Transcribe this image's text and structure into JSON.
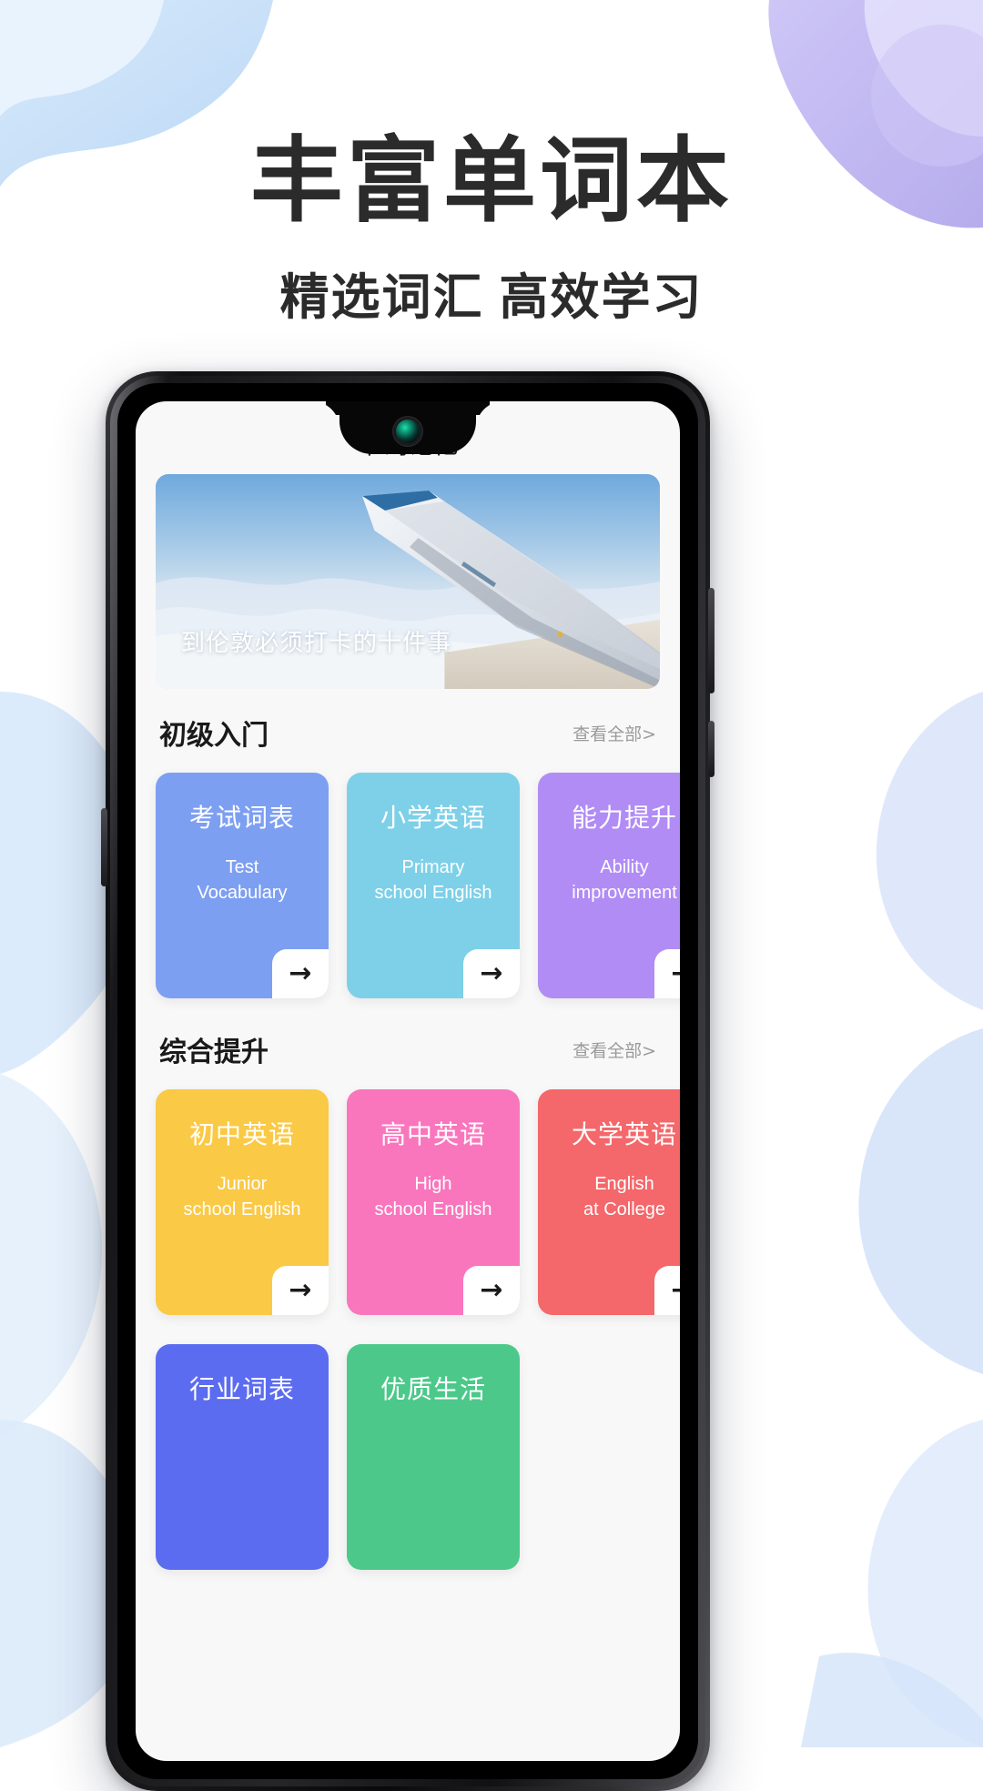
{
  "hero": {
    "title": "丰富单词本",
    "subtitle": "精选词汇 高效学习"
  },
  "colors": {
    "bg_blue": "#cfe4f7",
    "bg_purple": "#c9c2f2",
    "bg_page": "#ffffff",
    "text_dark": "#2b2b2b",
    "muted": "#9a9a9a"
  },
  "app": {
    "title": "单词记忆",
    "banner": {
      "caption": "到伦敦必须打卡的十件事"
    },
    "sections": [
      {
        "title": "初级入门",
        "more_label": "查看全部>",
        "cards": [
          {
            "cn": "考试词表",
            "en": "Test\nVocabulary",
            "color": "#7d9ff2",
            "arrow": "→"
          },
          {
            "cn": "小学英语",
            "en": "Primary\nschool English",
            "color": "#7ed0e8",
            "arrow": "→"
          },
          {
            "cn": "能力提升",
            "en": "Ability\nimprovement",
            "color": "#b18cf5",
            "arrow": "→"
          }
        ]
      },
      {
        "title": "综合提升",
        "more_label": "查看全部>",
        "cards": [
          {
            "cn": "初中英语",
            "en": "Junior\nschool English",
            "color": "#fac945",
            "arrow": "→"
          },
          {
            "cn": "高中英语",
            "en": "High\nschool English",
            "color": "#f976bd",
            "arrow": "→"
          },
          {
            "cn": "大学英语",
            "en": "English\nat College",
            "color": "#f4676a",
            "arrow": "→"
          }
        ]
      },
      {
        "title": "",
        "more_label": "",
        "cards": [
          {
            "cn": "行业词表",
            "en": "",
            "color": "#5b6cf0",
            "arrow": ""
          },
          {
            "cn": "优质生活",
            "en": "",
            "color": "#4cc98a",
            "arrow": ""
          }
        ]
      }
    ]
  }
}
